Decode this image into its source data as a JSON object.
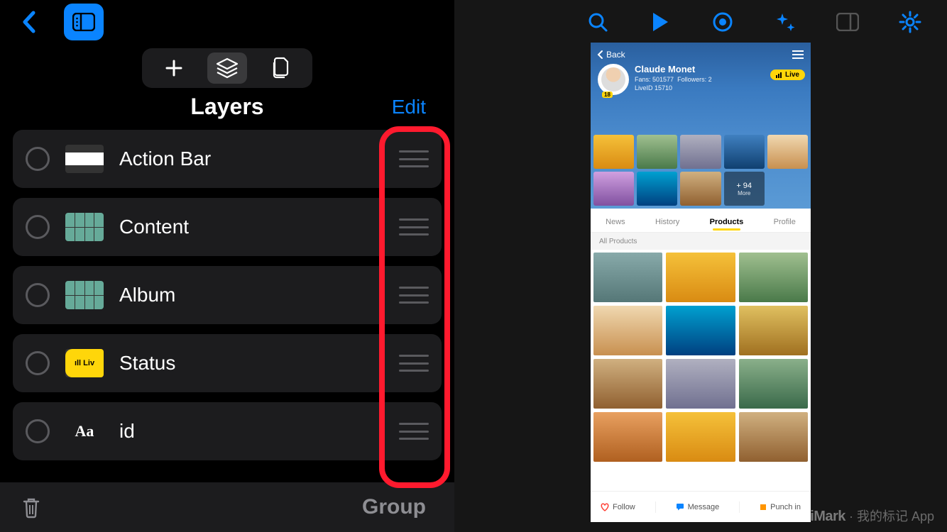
{
  "left": {
    "title": "Layers",
    "edit": "Edit",
    "footer_group": "Group",
    "layers": [
      {
        "name": "Action Bar"
      },
      {
        "name": "Content"
      },
      {
        "name": "Album"
      },
      {
        "name": "Status"
      },
      {
        "name": "id"
      }
    ]
  },
  "preview": {
    "back": "Back",
    "name": "Claude Monet",
    "fans_label": "Fans:",
    "fans": "501577",
    "followers_label": "Followers:",
    "followers": "2",
    "liveid_label": "LiveID",
    "liveid": "15710",
    "live_badge": "Live",
    "avatar_badge": "18",
    "more_count": "+ 94",
    "more_label": "More",
    "tabs": [
      "News",
      "History",
      "Products",
      "Profile"
    ],
    "active_tab": "Products",
    "subhead": "All Products",
    "footer": {
      "follow": "Follow",
      "message": "Message",
      "punch": "Punch in"
    }
  },
  "watermark": {
    "brand": "iMark",
    "sep": "·",
    "text": "我的标记 App"
  }
}
